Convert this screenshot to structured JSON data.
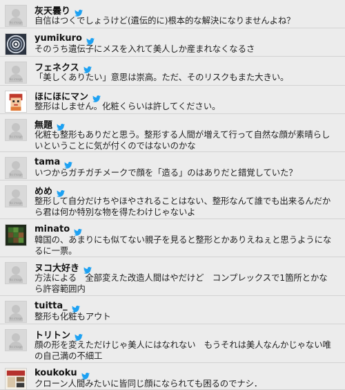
{
  "icons": {
    "verified_bird": "twitter-bird-icon",
    "bird_color": "#1da1f2"
  },
  "avatar_placeholder": "No image",
  "posts": [
    {
      "user": "灰天曇り",
      "text": "自信はつくでしょうけど(遺伝的に)根本的な解決になりませんよね？",
      "avatar": "placeholder"
    },
    {
      "user": "yumikuro",
      "text": "そのうち遺伝子にメスを入れて美人しか産まれなくなるさ",
      "avatar": "swirl-image"
    },
    {
      "user": "フェネクス",
      "text": "「美しくありたい」意思は崇高。ただ、そのリスクもまた大きい。",
      "avatar": "placeholder"
    },
    {
      "user": "ほにほにマン",
      "text": "整形はしません。化粧くらいは許してください。",
      "avatar": "pixel-character"
    },
    {
      "user": "無題",
      "text": "化粧も整形もありだと思う。整形する人間が増えて行って自然な顔が素晴らしいということに気が付くのではないのかな",
      "avatar": "placeholder"
    },
    {
      "user": "tama",
      "text": "いつからガチガチメークで顔を「造る」のはありだと錯覚していた？",
      "avatar": "placeholder"
    },
    {
      "user": "めめ",
      "text": "整形して自分だけちやほやされることはない、整形なんて誰でも出来るんだから君は何か特別な物を得たわけじゃないよ",
      "avatar": "placeholder"
    },
    {
      "user": "minato",
      "text": "韓国の、あまりにも似てない親子を見ると整形とかありえねぇと思うようになるに一票。",
      "avatar": "block-character"
    },
    {
      "user": "ヌコ大好き",
      "text": "方法による　全部変えた改造人間はやだけど　コンプレックスで1箇所とかなら許容範囲内",
      "avatar": "placeholder"
    },
    {
      "user": "tuitta_",
      "text": "整形も化粧もアウト",
      "avatar": "placeholder"
    },
    {
      "user": "トリトン",
      "text": "顔の形を変えただけじゃ美人にはなれない　もうそれは美人なんかじゃない唯の自己満の不細工",
      "avatar": "placeholder"
    },
    {
      "user": "koukoku",
      "text": "クローン人間みたいに皆同じ顔になられても困るのでナシ．",
      "avatar": "ad-thumbnail"
    }
  ]
}
